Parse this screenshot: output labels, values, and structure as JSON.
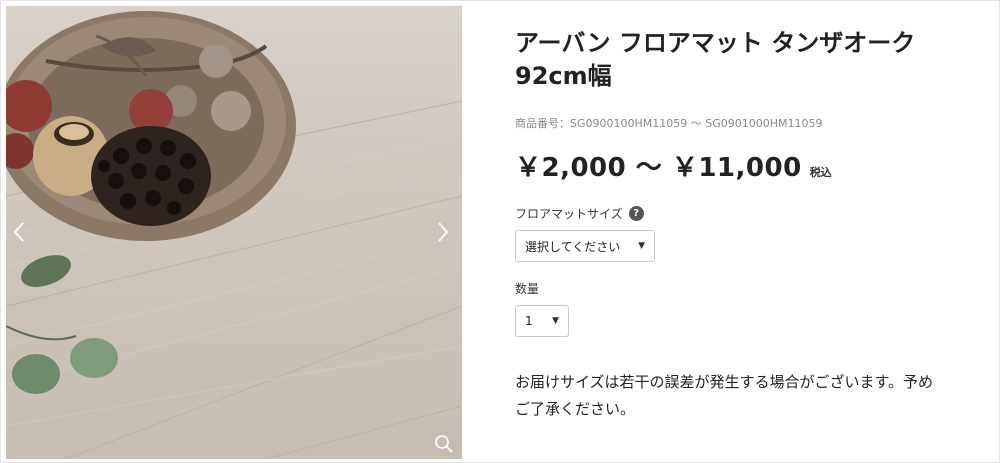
{
  "gallery": {
    "prev_icon": "chevron-left-icon",
    "next_icon": "chevron-right-icon",
    "zoom_icon": "magnifier-icon"
  },
  "product": {
    "title": "アーバン フロアマット タンザオーク 92cm幅",
    "sku_label": "商品番号：SG0900100HM11059 〜 SG0901000HM11059",
    "price_range": "￥2,000 〜 ￥11,000",
    "tax_label": "税込"
  },
  "options": {
    "size": {
      "label": "フロアマットサイズ",
      "help_icon_text": "?",
      "selected": "選択してください"
    },
    "quantity": {
      "label": "数量",
      "selected": "1"
    }
  },
  "note": "お届けサイズは若干の誤差が発生する場合がございます。予めご了承ください。",
  "colors": {
    "text": "#222222",
    "muted": "#888888",
    "border": "#c9c9c9",
    "image_wood": "#cfc6bd"
  }
}
